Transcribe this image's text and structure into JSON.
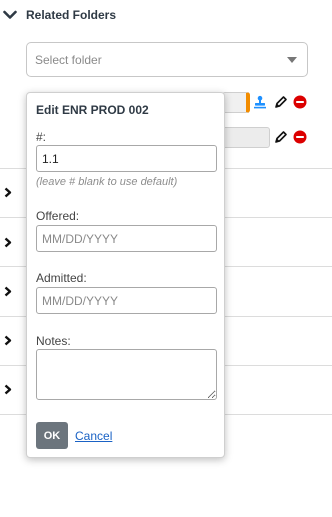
{
  "section": {
    "title": "Related Folders",
    "expand_icon": "chevron-down-icon"
  },
  "folder_select": {
    "placeholder": "Select folder"
  },
  "folder_rows": [
    {
      "accent_color": "#f28c00",
      "icons": [
        "stamp-icon",
        "pencil-icon",
        "remove-circle-icon"
      ]
    },
    {
      "icons": [
        "pencil-icon",
        "remove-circle-icon"
      ]
    }
  ],
  "expanders": {
    "count": 5,
    "icon": "chevron-right-icon"
  },
  "popover": {
    "title": "Edit ENR PROD 002",
    "number_label": "#:",
    "number_value": "1.1",
    "number_hint": "(leave # blank to use default)",
    "offered_label": "Offered:",
    "offered_placeholder": "MM/DD/YYYY",
    "admitted_label": "Admitted:",
    "admitted_placeholder": "MM/DD/YYYY",
    "notes_label": "Notes:",
    "notes_value": "",
    "ok_label": "OK",
    "cancel_label": "Cancel"
  },
  "colors": {
    "accent_orange": "#f28c00",
    "stamp_blue": "#1e90ff",
    "remove_red": "#dc0000",
    "link_blue": "#1a62c5",
    "ok_button": "#6c757d"
  }
}
